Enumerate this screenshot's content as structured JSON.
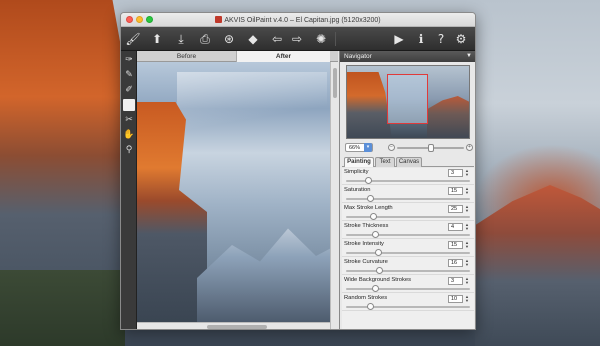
{
  "window": {
    "title": "AKVIS OilPaint v.4.0 – El Capitan.jpg (5120x3200)"
  },
  "toolbar": {
    "buttons": [
      {
        "name": "brush-logo",
        "glyph": "🖌"
      },
      {
        "name": "open",
        "glyph": "⬆"
      },
      {
        "name": "save",
        "glyph": "⤓"
      },
      {
        "name": "print",
        "glyph": "⎙"
      },
      {
        "name": "share",
        "glyph": "⊛"
      },
      {
        "name": "settings-eraser",
        "glyph": "◆"
      },
      {
        "name": "undo",
        "glyph": "⇦"
      },
      {
        "name": "redo",
        "glyph": "⇨"
      },
      {
        "name": "magic",
        "glyph": "✺"
      },
      {
        "name": "run",
        "glyph": "▶"
      },
      {
        "name": "info",
        "glyph": "ℹ"
      },
      {
        "name": "help",
        "glyph": "?"
      },
      {
        "name": "preferences",
        "glyph": "⚙"
      }
    ]
  },
  "tools": [
    {
      "name": "brush",
      "glyph": "✑"
    },
    {
      "name": "smudge",
      "glyph": "✎"
    },
    {
      "name": "stroke",
      "glyph": "✐"
    },
    {
      "name": "blank",
      "glyph": ""
    },
    {
      "name": "eraser",
      "glyph": "✂"
    },
    {
      "name": "hand",
      "glyph": "✋"
    },
    {
      "name": "zoom",
      "glyph": "⚲"
    }
  ],
  "canvas": {
    "tab_before": "Before",
    "tab_after": "After"
  },
  "navigator": {
    "header": "Navigator",
    "zoom": "66%",
    "zoom_fraction": 0.5
  },
  "settings": {
    "tabs": [
      "Painting",
      "Text",
      "Canvas"
    ],
    "params": [
      {
        "label": "Simplicity",
        "value": "3",
        "fraction": 0.18
      },
      {
        "label": "Saturation",
        "value": "15",
        "fraction": 0.2
      },
      {
        "label": "Max Stroke Length",
        "value": "25",
        "fraction": 0.22
      },
      {
        "label": "Stroke Thickness",
        "value": "4",
        "fraction": 0.24
      },
      {
        "label": "Stroke Intensity",
        "value": "15",
        "fraction": 0.26
      },
      {
        "label": "Stroke Curvature",
        "value": "16",
        "fraction": 0.27
      },
      {
        "label": "Wide Background Strokes",
        "value": "3",
        "fraction": 0.24
      },
      {
        "label": "Random Strokes",
        "value": "10",
        "fraction": 0.2
      }
    ]
  }
}
